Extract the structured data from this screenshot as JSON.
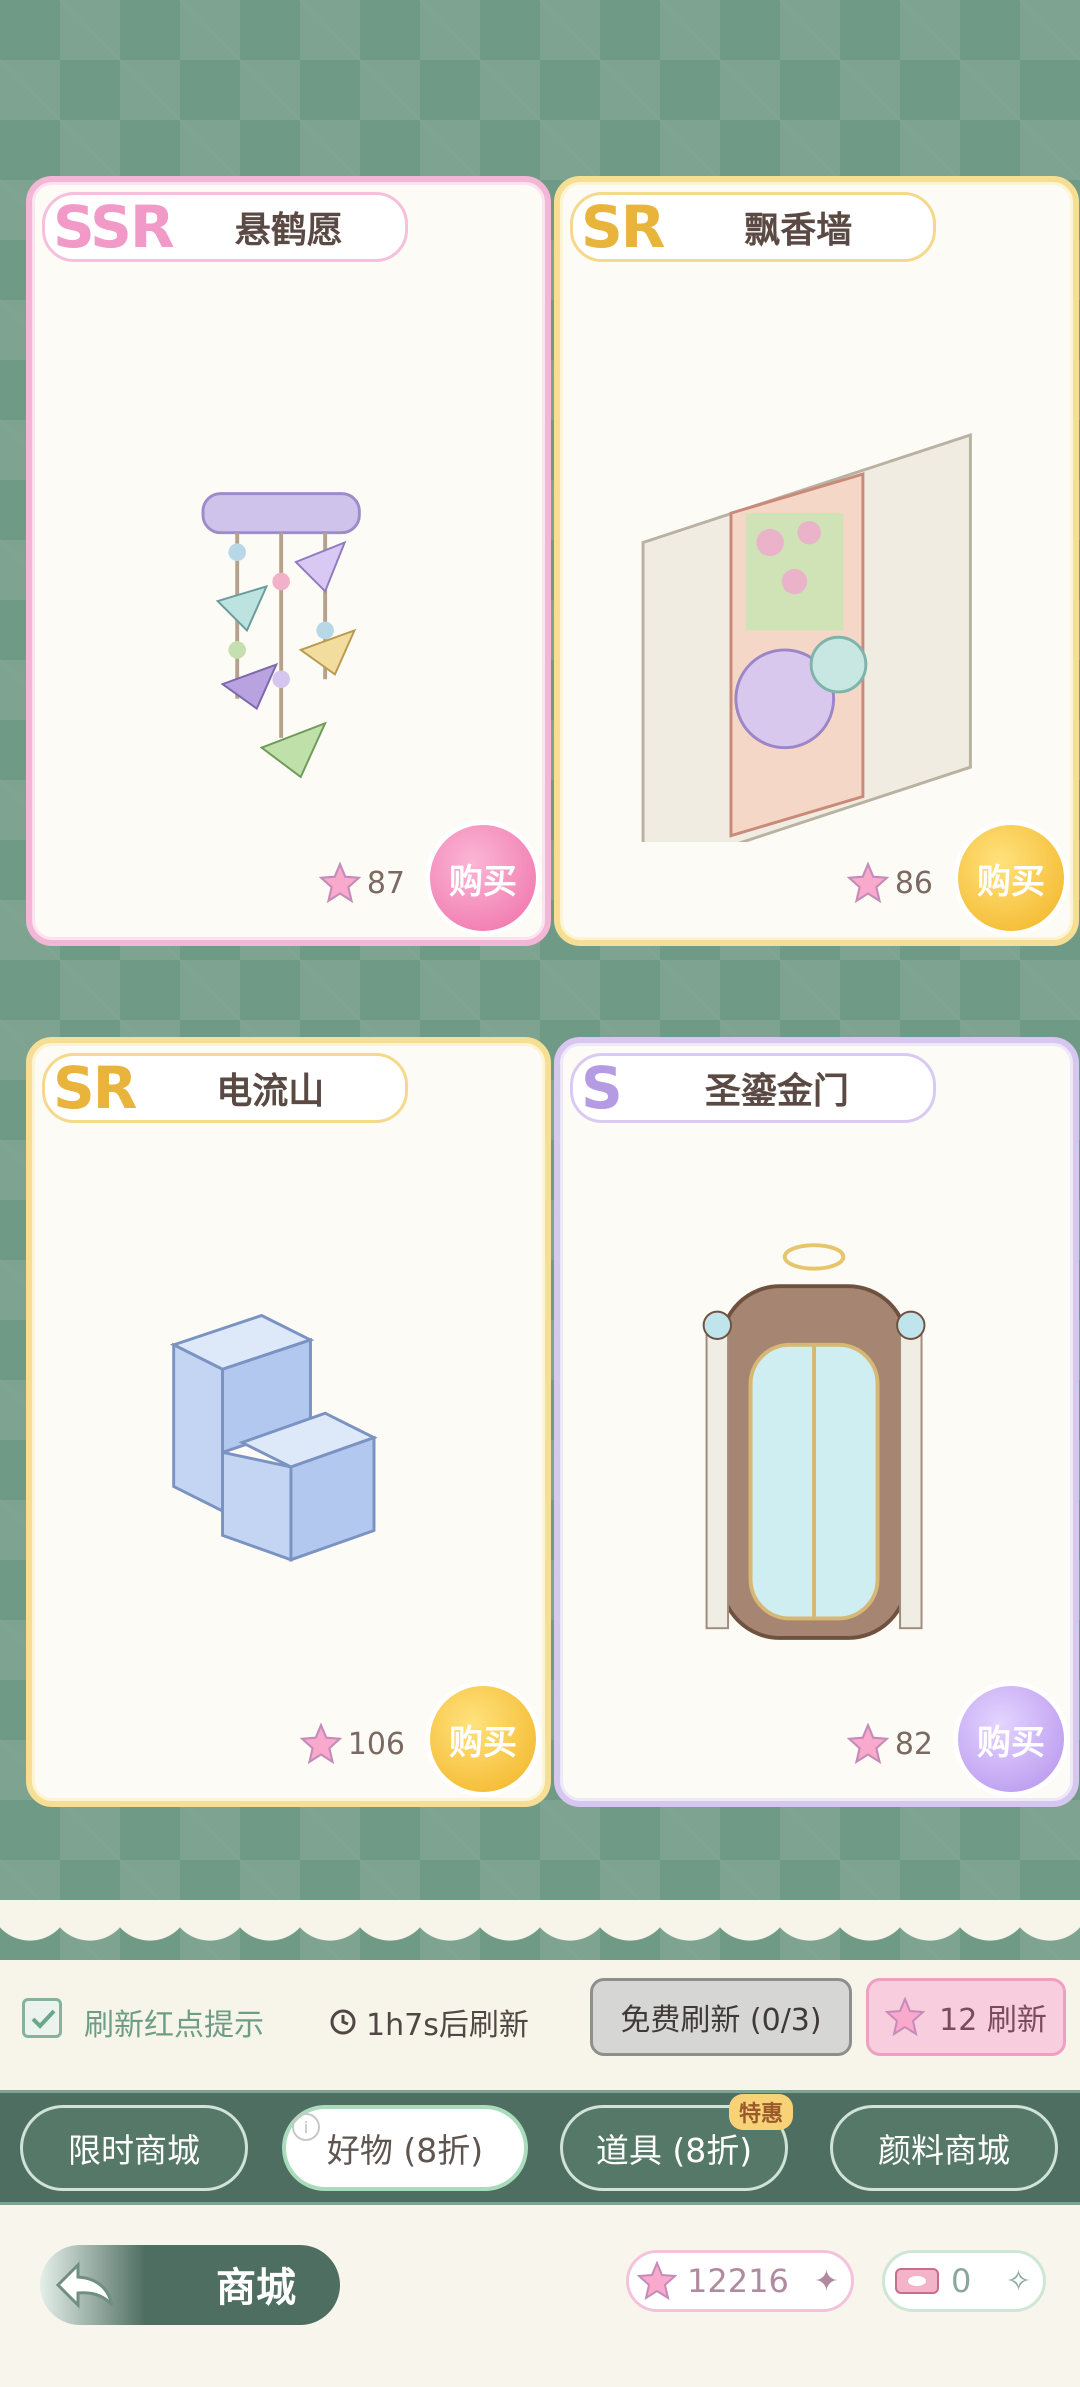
{
  "cards": [
    {
      "rarity": "SSR",
      "name": "悬鹤愿",
      "price": "87",
      "buy_label": "购买"
    },
    {
      "rarity": "SR",
      "name": "飘香墙",
      "price": "86",
      "buy_label": "购买"
    },
    {
      "rarity": "SR",
      "name": "电流山",
      "price": "106",
      "buy_label": "购买"
    },
    {
      "rarity": "S",
      "name": "圣鎏金门",
      "price": "82",
      "buy_label": "购买"
    }
  ],
  "refresh": {
    "reminder_label": "刷新红点提示",
    "timer_text": "1h7s后刷新",
    "free_button": "免费刷新 (0/3)",
    "paid_button": "12 刷新"
  },
  "tabs": [
    {
      "label": "限时商城"
    },
    {
      "label": "好物 (8折)"
    },
    {
      "label": "道具 (8折)",
      "badge": "特惠"
    },
    {
      "label": "颜料商城"
    }
  ],
  "footer": {
    "title": "商城",
    "star_currency": "12216",
    "ticket_currency": "0"
  }
}
